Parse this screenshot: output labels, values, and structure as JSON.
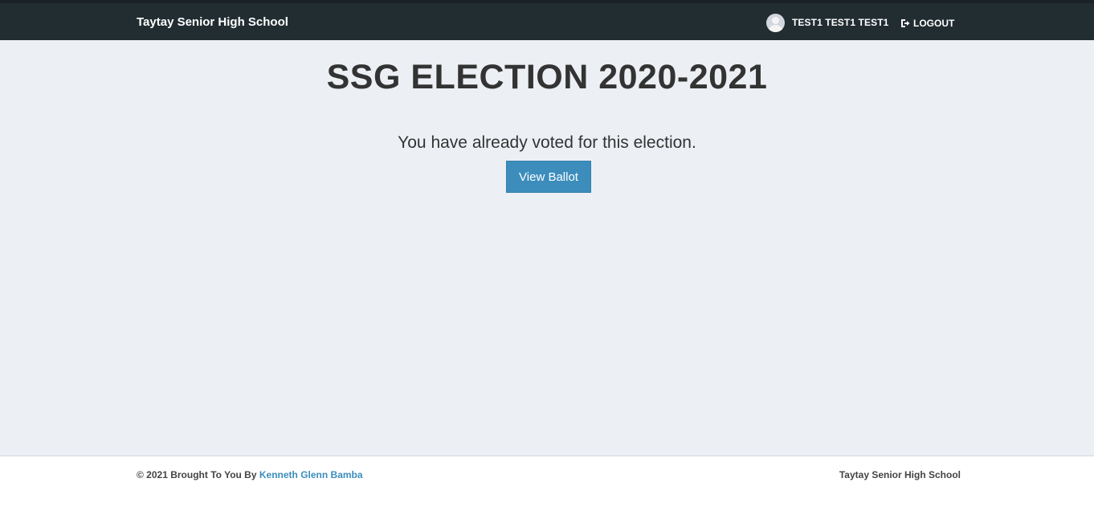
{
  "header": {
    "brand": "Taytay Senior High School",
    "user_name": "TEST1 TEST1 TEST1",
    "logout_label": "LOGOUT"
  },
  "main": {
    "title": "SSG ELECTION 2020-2021",
    "message": "You have already voted for this election.",
    "view_ballot_label": "View Ballot"
  },
  "footer": {
    "credit_prefix": "© 2021 Brought To You By",
    "credit_link": "Kenneth Glenn Bamba",
    "school": "Taytay Senior High School"
  },
  "colors": {
    "navbar": "#222d32",
    "background": "#ecf0f5",
    "primary": "#3c8dbc"
  },
  "icons": {
    "avatar": "user-avatar-icon",
    "logout": "sign-out-icon"
  }
}
